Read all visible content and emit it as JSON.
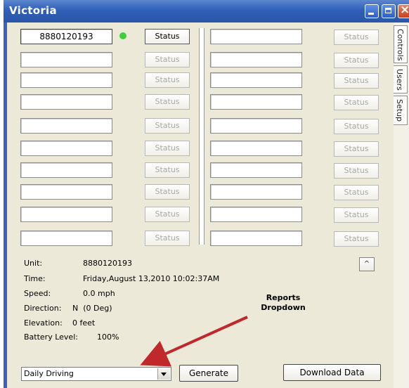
{
  "window": {
    "title": "Victoria"
  },
  "side_tabs": [
    "Controls",
    "Users",
    "Setup"
  ],
  "units": {
    "left": [
      {
        "id": "8880120193",
        "status": "Status"
      },
      {
        "id": "",
        "status": "Status"
      },
      {
        "id": "",
        "status": "Status"
      },
      {
        "id": "",
        "status": "Status"
      },
      {
        "id": "",
        "status": "Status"
      },
      {
        "id": "",
        "status": "Status"
      },
      {
        "id": "",
        "status": "Status"
      },
      {
        "id": "",
        "status": "Status"
      },
      {
        "id": "",
        "status": "Status"
      },
      {
        "id": "",
        "status": "Status"
      }
    ],
    "right": [
      {
        "id": "",
        "status": "Status"
      },
      {
        "id": "",
        "status": "Status"
      },
      {
        "id": "",
        "status": "Status"
      },
      {
        "id": "",
        "status": "Status"
      },
      {
        "id": "",
        "status": "Status"
      },
      {
        "id": "",
        "status": "Status"
      },
      {
        "id": "",
        "status": "Status"
      },
      {
        "id": "",
        "status": "Status"
      },
      {
        "id": "",
        "status": "Status"
      },
      {
        "id": "",
        "status": "Status"
      }
    ]
  },
  "details": {
    "unit_label": "Unit:",
    "unit_value": "8880120193",
    "time_label": "Time:",
    "time_value": "Friday,August 13,2010 10:02:37AM",
    "speed_label": "Speed:",
    "speed_value": "0.0 mph",
    "direction_label": "Direction:",
    "direction_value": "N  (0 Deg)",
    "elevation_label": "Elevation:",
    "elevation_value": "0 feet",
    "battery_label": "Battery Level:",
    "battery_value": "100%"
  },
  "scroll_up_glyph": "^",
  "annotation": {
    "line1": "Reports",
    "line2": "Dropdown"
  },
  "reports": {
    "selected": "Daily Driving",
    "generate_label": "Generate",
    "download_label": "Download Data"
  },
  "colors": {
    "title_bar": "#2f5fb8",
    "status_online": "#3fcf3c",
    "annotation_arrow": "#c0282b"
  }
}
